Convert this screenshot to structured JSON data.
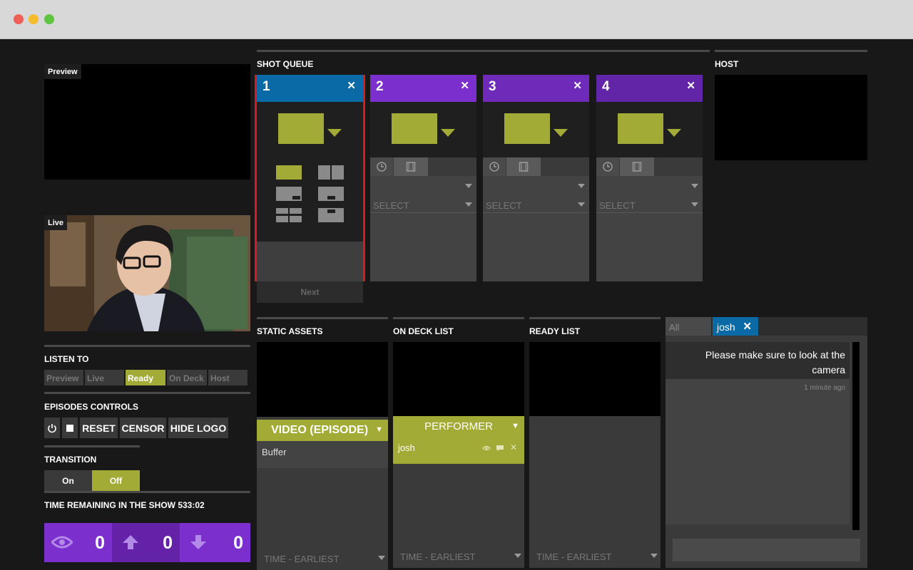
{
  "left": {
    "preview_label": "Preview",
    "live_label": "Live",
    "listen_to": {
      "heading": "LISTEN TO",
      "tabs": [
        {
          "label": "Preview",
          "active": false
        },
        {
          "label": "Live",
          "active": false
        },
        {
          "label": "Ready",
          "active": true
        },
        {
          "label": "On Deck",
          "active": false
        },
        {
          "label": "Host",
          "active": false
        }
      ]
    },
    "episodes": {
      "heading": "EPISODES CONTROLS",
      "reset": "RESET",
      "censor": "CENSOR",
      "hide_logo": "HIDE LOGO"
    },
    "transition": {
      "heading": "TRANSITION",
      "on": "On",
      "off": "Off",
      "selected": "Off"
    },
    "time_remaining": "TIME REMAINING IN THE SHOW 533:02",
    "stats": {
      "views": "0",
      "upvotes": "0",
      "downvotes": "0"
    }
  },
  "shot_queue": {
    "heading": "SHOT QUEUE",
    "close_glyph": "✕",
    "cards": [
      {
        "number": "1",
        "color": "#0a6aa6"
      },
      {
        "number": "2",
        "color": "#7b2fcc",
        "select": "SELECT"
      },
      {
        "number": "3",
        "color": "#6e2ab8",
        "select": "SELECT"
      },
      {
        "number": "4",
        "color": "#6225a8",
        "select": "SELECT"
      }
    ],
    "next_label": "Next"
  },
  "host": {
    "heading": "HOST"
  },
  "static_assets": {
    "heading": "STATIC ASSETS",
    "dropdown": "VIDEO (EPISODE)",
    "item": "Buffer",
    "sort": "TIME - EARLIEST"
  },
  "on_deck": {
    "heading": "ON DECK LIST",
    "group": "PERFORMER",
    "item": "josh",
    "sort": "TIME - EARLIEST"
  },
  "ready": {
    "heading": "READY LIST",
    "sort": "TIME - EARLIEST"
  },
  "chat": {
    "tab_all": "All",
    "tab_user": "josh",
    "message": "Please make sure to look at the camera",
    "timestamp": "1 minute ago"
  },
  "colors": {
    "accent_lime": "#a2ab35",
    "accent_purple": "#7b2fcc",
    "active_blue": "#0a6aa6",
    "queue_highlight": "#e01818"
  }
}
